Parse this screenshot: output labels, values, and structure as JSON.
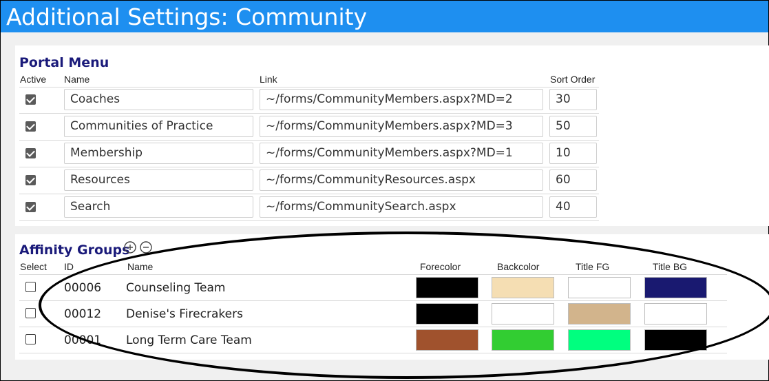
{
  "window": {
    "title": "Additional Settings: Community"
  },
  "portal_menu": {
    "title": "Portal Menu",
    "columns": {
      "active": "Active",
      "name": "Name",
      "link": "Link",
      "sort": "Sort Order"
    },
    "rows": [
      {
        "active": true,
        "name": "Coaches",
        "link": "~/forms/CommunityMembers.aspx?MD=2",
        "sort": "30"
      },
      {
        "active": true,
        "name": "Communities of Practice",
        "link": "~/forms/CommunityMembers.aspx?MD=3",
        "sort": "50"
      },
      {
        "active": true,
        "name": "Membership",
        "link": "~/forms/CommunityMembers.aspx?MD=1",
        "sort": "10"
      },
      {
        "active": true,
        "name": "Resources",
        "link": "~/forms/CommunityResources.aspx",
        "sort": "60"
      },
      {
        "active": true,
        "name": "Search",
        "link": "~/forms/CommunitySearch.aspx",
        "sort": "40"
      }
    ]
  },
  "affinity_groups": {
    "title": "Affinity Groups",
    "icons": {
      "add": "plus-circle-icon",
      "remove": "minus-circle-icon"
    },
    "columns": {
      "select": "Select",
      "id": "ID",
      "name": "Name",
      "forecolor": "Forecolor",
      "backcolor": "Backcolor",
      "title_fg": "Title FG",
      "title_bg": "Title BG"
    },
    "rows": [
      {
        "selected": false,
        "id": "00006",
        "name": "Counseling Team",
        "forecolor": "#000000",
        "backcolor": "#f5deb3",
        "title_fg": "#ffffff",
        "title_bg": "#191970"
      },
      {
        "selected": false,
        "id": "00012",
        "name": "Denise's Firecrakers",
        "forecolor": "#000000",
        "backcolor": "#ffffff",
        "title_fg": "#d2b48c",
        "title_bg": "#ffffff"
      },
      {
        "selected": false,
        "id": "00001",
        "name": "Long Term Care Team",
        "forecolor": "#a0522d",
        "backcolor": "#32cd32",
        "title_fg": "#00ff7f",
        "title_bg": "#000000"
      }
    ]
  },
  "colors": {
    "title_bar": "#1e8ff0",
    "section_title": "#1a1a7a",
    "annotation": "#000000"
  }
}
